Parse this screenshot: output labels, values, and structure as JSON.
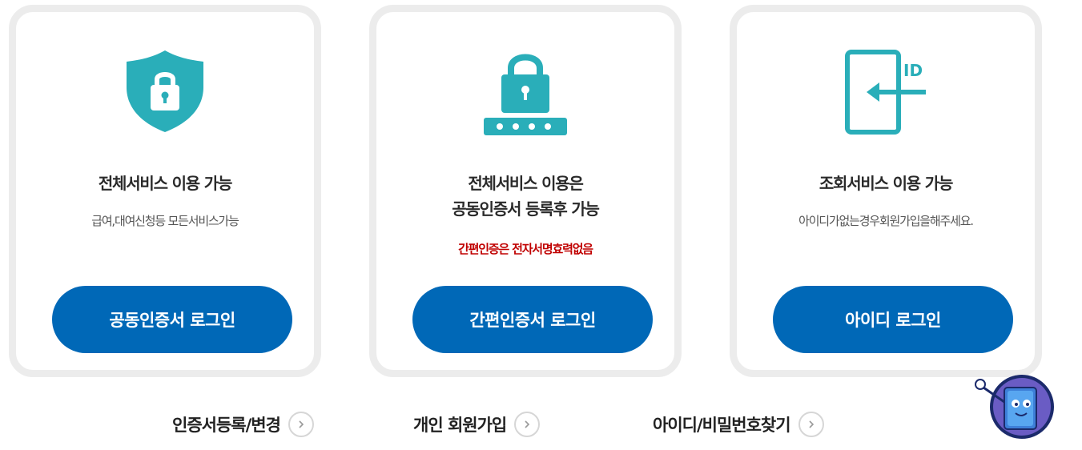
{
  "colors": {
    "teal": "#2aaeb9",
    "button_blue": "#0068b7",
    "warning_red": "#c00000",
    "card_border": "#ececec"
  },
  "cards": [
    {
      "icon": "shield-lock-icon",
      "title_lines": [
        "전체서비스 이용 가능"
      ],
      "description": "급여,대여신청등 모든서비스가능",
      "button_label": "공동인증서 로그인"
    },
    {
      "icon": "padlock-password-icon",
      "title_lines": [
        "전체서비스 이용은",
        "공동인증서 등록후 가능"
      ],
      "warning": "간편인증은 전자서명효력없음",
      "button_label": "간편인증서 로그인"
    },
    {
      "icon": "id-login-icon",
      "icon_text": "ID",
      "title_lines": [
        "조회서비스 이용 가능"
      ],
      "description": "아이디가없는경우회원가입을해주세요.",
      "button_label": "아이디 로그인"
    }
  ],
  "links": [
    {
      "label": "인증서등록/변경"
    },
    {
      "label": "개인 회원가입"
    },
    {
      "label": "아이디/비밀번호찾기"
    }
  ]
}
